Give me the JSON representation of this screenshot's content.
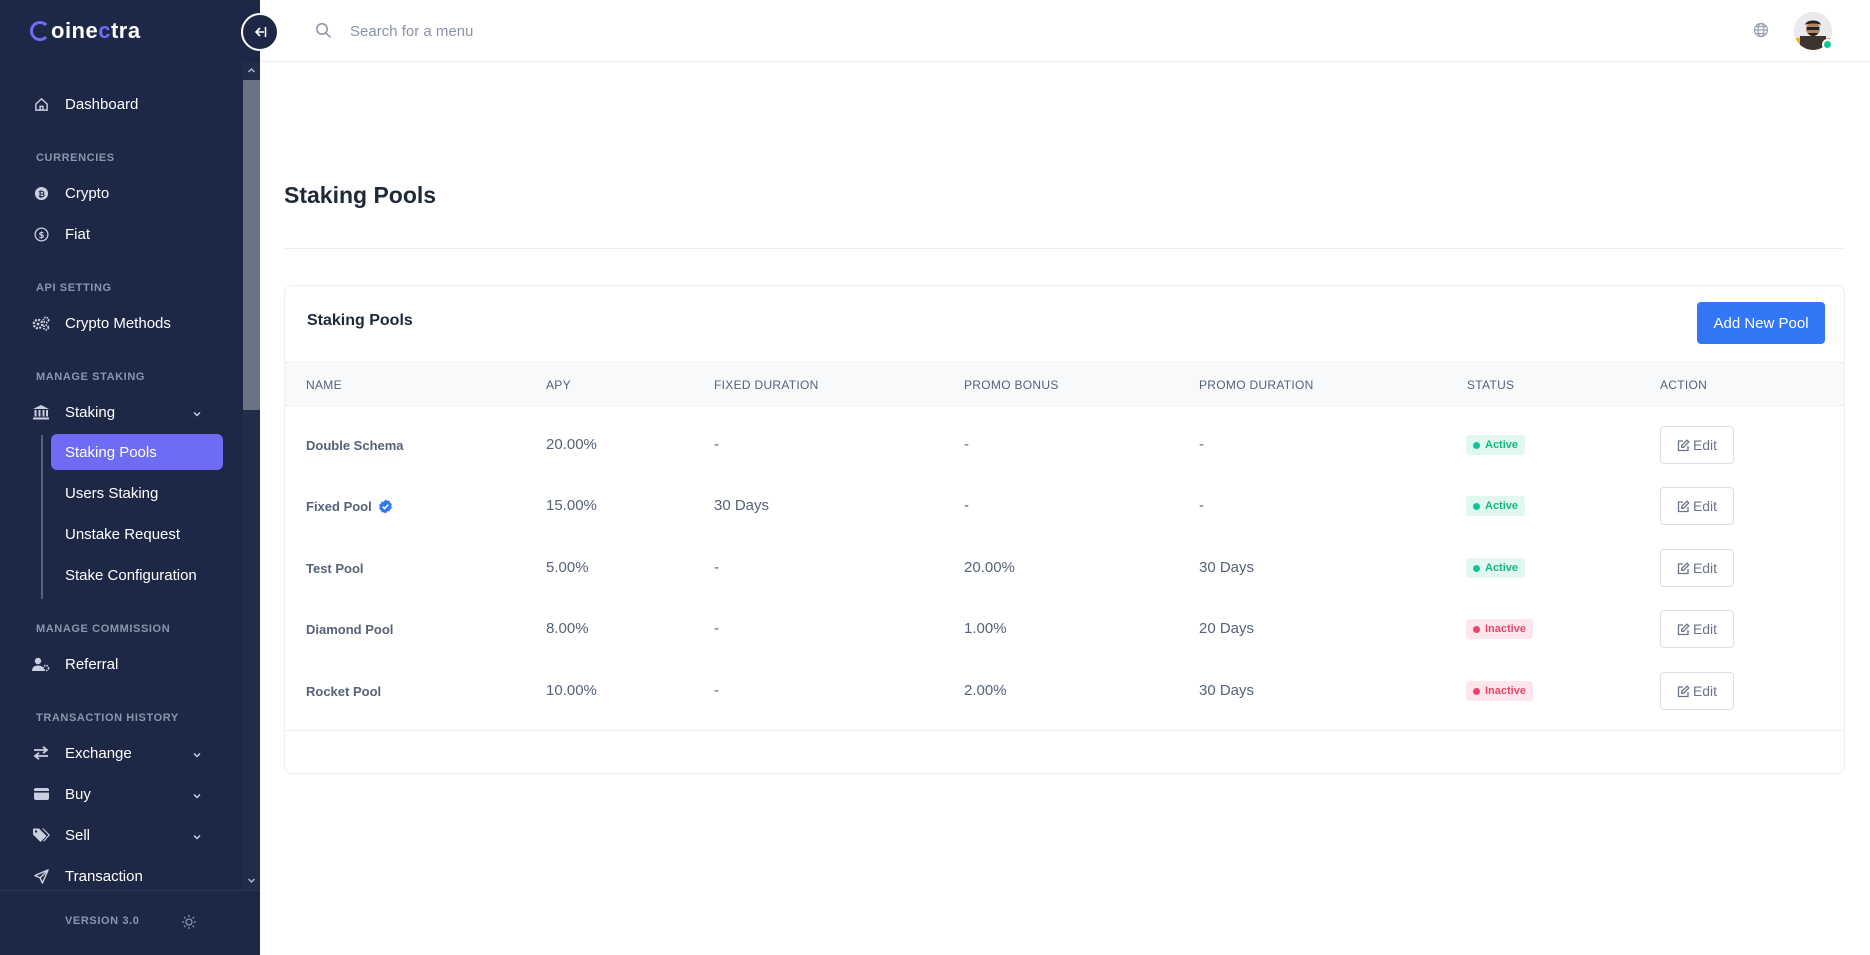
{
  "brand": {
    "prefix": "oine",
    "accent": "c",
    "suffix": "tra"
  },
  "sidebar": {
    "dashboard": "Dashboard",
    "sections": {
      "currencies": "CURRENCIES",
      "api": "API SETTING",
      "staking": "MANAGE STAKING",
      "commission": "MANAGE COMMISSION",
      "transactions": "TRANSACTION HISTORY"
    },
    "crypto": "Crypto",
    "fiat": "Fiat",
    "crypto_methods": "Crypto Methods",
    "staking": "Staking",
    "staking_sub": [
      "Staking Pools",
      "Users Staking",
      "Unstake Request",
      "Stake Configuration"
    ],
    "referral": "Referral",
    "exchange": "Exchange",
    "buy": "Buy",
    "sell": "Sell",
    "transaction": "Transaction",
    "version": "VERSION 3.0"
  },
  "header": {
    "search_placeholder": "Search for a menu"
  },
  "page": {
    "title": "Staking Pools",
    "card_title": "Staking Pools",
    "add_button": "Add New Pool"
  },
  "table": {
    "columns": [
      "NAME",
      "APY",
      "FIXED DURATION",
      "PROMO BONUS",
      "PROMO DURATION",
      "STATUS",
      "ACTION"
    ],
    "rows": [
      {
        "name": "Double Schema",
        "apy": "20.00%",
        "fixed": "-",
        "bonus": "-",
        "promo_duration": "-",
        "status": "Active",
        "action": "Edit"
      },
      {
        "name": "Fixed Pool",
        "apy": "15.00%",
        "fixed": "30 Days",
        "bonus": "-",
        "promo_duration": "-",
        "status": "Active",
        "action": "Edit"
      },
      {
        "name": "Test Pool",
        "apy": "5.00%",
        "fixed": "-",
        "bonus": "20.00%",
        "promo_duration": "30 Days",
        "status": "Active",
        "action": "Edit"
      },
      {
        "name": "Diamond Pool",
        "apy": "8.00%",
        "fixed": "-",
        "bonus": "1.00%",
        "promo_duration": "20 Days",
        "status": "Inactive",
        "action": "Edit"
      },
      {
        "name": "Rocket Pool",
        "apy": "10.00%",
        "fixed": "-",
        "bonus": "2.00%",
        "promo_duration": "30 Days",
        "status": "Inactive",
        "action": "Edit"
      }
    ]
  },
  "colors": {
    "sidebar_bg": "#1c2846",
    "accent": "#6e6bf5",
    "primary_button": "#3477f6",
    "active": "#10c59a",
    "inactive": "#f0426a"
  },
  "icons": {
    "dashboard": "home-icon",
    "crypto": "bitcoin-icon",
    "fiat": "dollar-icon",
    "crypto_methods": "gears-icon",
    "staking": "bank-icon",
    "referral": "user-cog-icon",
    "exchange": "arrows-swap-icon",
    "buy": "wallet-icon",
    "sell": "tags-icon",
    "transaction": "send-icon"
  }
}
